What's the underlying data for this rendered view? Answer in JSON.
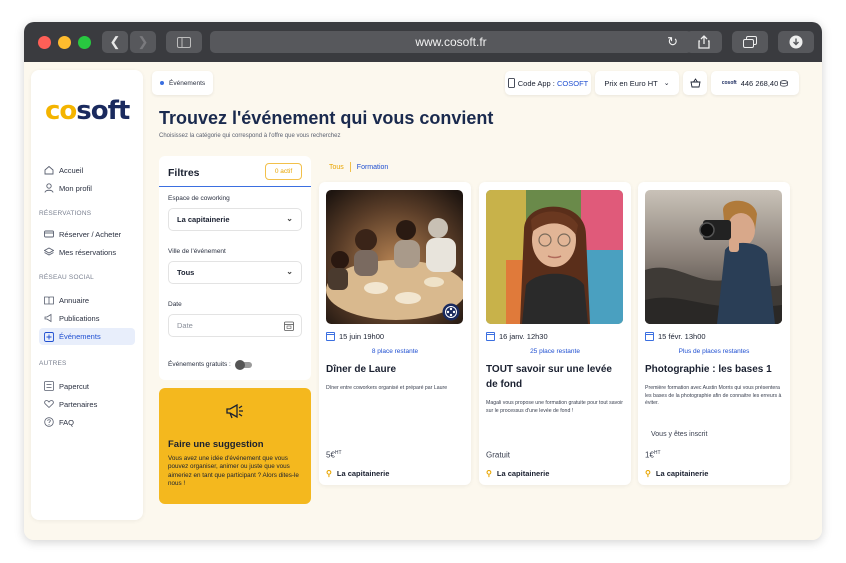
{
  "browser": {
    "url": "www.cosoft.fr",
    "colors": {
      "close": "#fe5f57",
      "minimize": "#febc2e",
      "maximize": "#28c840"
    },
    "icons": [
      "back-icon",
      "forward-icon",
      "sidebar-icon",
      "reload-icon",
      "share-icon",
      "tabs-icon",
      "download-icon"
    ]
  },
  "brand": {
    "logo": "cosoft",
    "accent": "#f4b400",
    "navy": "#1a2a5e",
    "blue": "#1f4fd1"
  },
  "sidebar": {
    "items": [
      {
        "label": "Accueil",
        "icon": "home-icon"
      },
      {
        "label": "Mon profil",
        "icon": "user-icon"
      }
    ],
    "sections": [
      {
        "title": "RÉSERVATIONS",
        "items": [
          {
            "label": "Réserver / Acheter",
            "icon": "card-icon"
          },
          {
            "label": "Mes réservations",
            "icon": "layers-icon"
          }
        ]
      },
      {
        "title": "RÉSEAU SOCIAL",
        "items": [
          {
            "label": "Annuaire",
            "icon": "book-icon"
          },
          {
            "label": "Publications",
            "icon": "megaphone-icon"
          },
          {
            "label": "Événements",
            "icon": "calendar-plus-icon",
            "active": true
          }
        ]
      },
      {
        "title": "AUTRES",
        "items": [
          {
            "label": "Papercut",
            "icon": "printer-icon"
          },
          {
            "label": "Partenaires",
            "icon": "heart-icon"
          },
          {
            "label": "FAQ",
            "icon": "help-icon"
          }
        ]
      }
    ]
  },
  "header": {
    "breadcrumb": "Événements",
    "code_app_label": "Code App : ",
    "code_app_value": "COSOFT",
    "price_mode": "Prix en Euro HT",
    "wallet_brand": "cosoft",
    "wallet_amount": "446 268,40"
  },
  "page": {
    "title": "Trouvez l'événement qui vous convient",
    "subtitle": "Choisissez la catégorie qui correspond à l'offre que vous recherchez"
  },
  "filters": {
    "title": "Filtres",
    "active_badge": "0 actif",
    "space_label": "Espace de coworking",
    "space_value": "La capitainerie",
    "city_label": "Ville de l'événement",
    "city_value": "Tous",
    "date_label": "Date",
    "date_placeholder": "Date",
    "free_label": "Événements gratuits :"
  },
  "suggestion": {
    "title": "Faire une suggestion",
    "text": "Vous avez une idée d'événement que vous pouvez organiser, animer ou juste que vous aimeriez en tant que participant ? Alors dites-le nous !"
  },
  "categories": [
    "Tous",
    "Formation"
  ],
  "events": [
    {
      "date": "15 juin 19h00",
      "places": "8 place restante",
      "title": "Dîner de Laure",
      "description": "Dîner entre coworkers organisé et préparé par Laure",
      "price": "5€",
      "price_suffix": "HT",
      "location": "La capitainerie"
    },
    {
      "date": "16 janv. 12h30",
      "places": "25 place restante",
      "title": "TOUT savoir sur une levée de fond",
      "description": "Magali vous propose une formation gratuite pour tout savoir sur le processus d'une levée de fond !",
      "price": "Gratuit",
      "price_suffix": "",
      "location": "La capitainerie"
    },
    {
      "date": "15 févr. 13h00",
      "places": "Plus de places restantes",
      "title": "Photographie : les bases 1",
      "description": "Première formation avec Austin Morris qui vous présentera les bases de la photographie afin de connaitre les erreurs à éviter.",
      "status": "Vous y êtes inscrit",
      "price": "1€",
      "price_suffix": "HT",
      "location": "La capitainerie"
    }
  ]
}
